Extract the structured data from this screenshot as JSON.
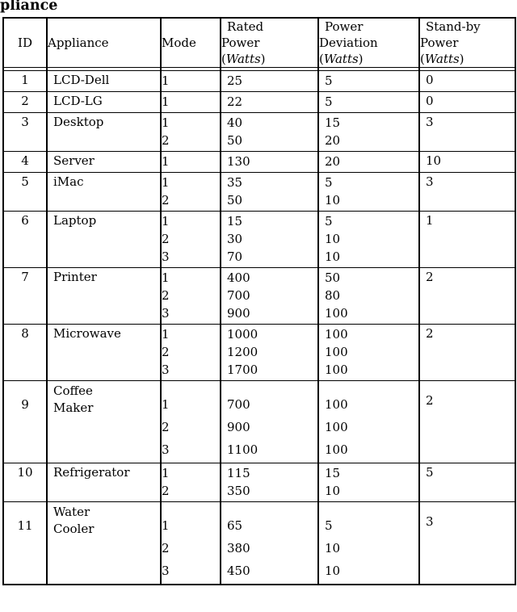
{
  "caption": {
    "partial_text": "pliance"
  },
  "table": {
    "columns": [
      {
        "key": "id",
        "label": "ID",
        "unit": ""
      },
      {
        "key": "appliance",
        "label": "Appliance",
        "unit": ""
      },
      {
        "key": "mode",
        "label": "Mode",
        "unit": ""
      },
      {
        "key": "rated",
        "label_line1": "Rated",
        "label_line2": "Power",
        "unit": "Watts"
      },
      {
        "key": "deviation",
        "label_line1": "Power",
        "label_line2": "Deviation",
        "unit": "Watts"
      },
      {
        "key": "standby",
        "label_line1": "Stand-by",
        "label_line2": "Power",
        "unit": "Watts"
      }
    ],
    "unit_open_paren": "(",
    "unit_close_paren": ")",
    "rows": [
      {
        "id": "1",
        "appliance": "LCD-Dell",
        "standby": "0",
        "modes": [
          {
            "mode": "1",
            "rated": "25",
            "deviation": "5"
          }
        ]
      },
      {
        "id": "2",
        "appliance": "LCD-LG",
        "standby": "0",
        "modes": [
          {
            "mode": "1",
            "rated": "22",
            "deviation": "5"
          }
        ]
      },
      {
        "id": "3",
        "appliance": "Desktop",
        "standby": "3",
        "modes": [
          {
            "mode": "1",
            "rated": "40",
            "deviation": "15"
          },
          {
            "mode": "2",
            "rated": "50",
            "deviation": "20"
          }
        ]
      },
      {
        "id": "4",
        "appliance": "Server",
        "standby": "10",
        "modes": [
          {
            "mode": "1",
            "rated": "130",
            "deviation": "20"
          }
        ]
      },
      {
        "id": "5",
        "appliance": "iMac",
        "standby": "3",
        "modes": [
          {
            "mode": "1",
            "rated": "35",
            "deviation": "5"
          },
          {
            "mode": "2",
            "rated": "50",
            "deviation": "10"
          }
        ]
      },
      {
        "id": "6",
        "appliance": "Laptop",
        "standby": "1",
        "modes": [
          {
            "mode": "1",
            "rated": "15",
            "deviation": "5"
          },
          {
            "mode": "2",
            "rated": "30",
            "deviation": "10"
          },
          {
            "mode": "3",
            "rated": "70",
            "deviation": "10"
          }
        ]
      },
      {
        "id": "7",
        "appliance": "Printer",
        "standby": "2",
        "modes": [
          {
            "mode": "1",
            "rated": "400",
            "deviation": "50"
          },
          {
            "mode": "2",
            "rated": "700",
            "deviation": "80"
          },
          {
            "mode": "3",
            "rated": "900",
            "deviation": "100"
          }
        ]
      },
      {
        "id": "8",
        "appliance": "Microwave",
        "standby": "2",
        "modes": [
          {
            "mode": "1",
            "rated": "1000",
            "deviation": "100"
          },
          {
            "mode": "2",
            "rated": "1200",
            "deviation": "100"
          },
          {
            "mode": "3",
            "rated": "1700",
            "deviation": "100"
          }
        ]
      },
      {
        "id": "9",
        "appliance": "Coffee Maker",
        "appliance_line1": "Coffee",
        "appliance_line2": "Maker",
        "standby": "2",
        "wrapped": true,
        "modes": [
          {
            "mode": "1",
            "rated": "700",
            "deviation": "100"
          },
          {
            "mode": "2",
            "rated": "900",
            "deviation": "100"
          },
          {
            "mode": "3",
            "rated": "1100",
            "deviation": "100"
          }
        ]
      },
      {
        "id": "10",
        "appliance": "Refrigerator",
        "standby": "5",
        "modes": [
          {
            "mode": "1",
            "rated": "115",
            "deviation": "15"
          },
          {
            "mode": "2",
            "rated": "350",
            "deviation": "10"
          }
        ]
      },
      {
        "id": "11",
        "appliance": "Water Cooler",
        "appliance_line1": "Water",
        "appliance_line2": "Cooler",
        "standby": "3",
        "wrapped": true,
        "modes": [
          {
            "mode": "1",
            "rated": "65",
            "deviation": "5"
          },
          {
            "mode": "2",
            "rated": "380",
            "deviation": "10"
          },
          {
            "mode": "3",
            "rated": "450",
            "deviation": "10"
          }
        ]
      }
    ]
  },
  "style": {
    "text_color": "#000000",
    "rule_color": "#000000",
    "background": "#ffffff"
  }
}
